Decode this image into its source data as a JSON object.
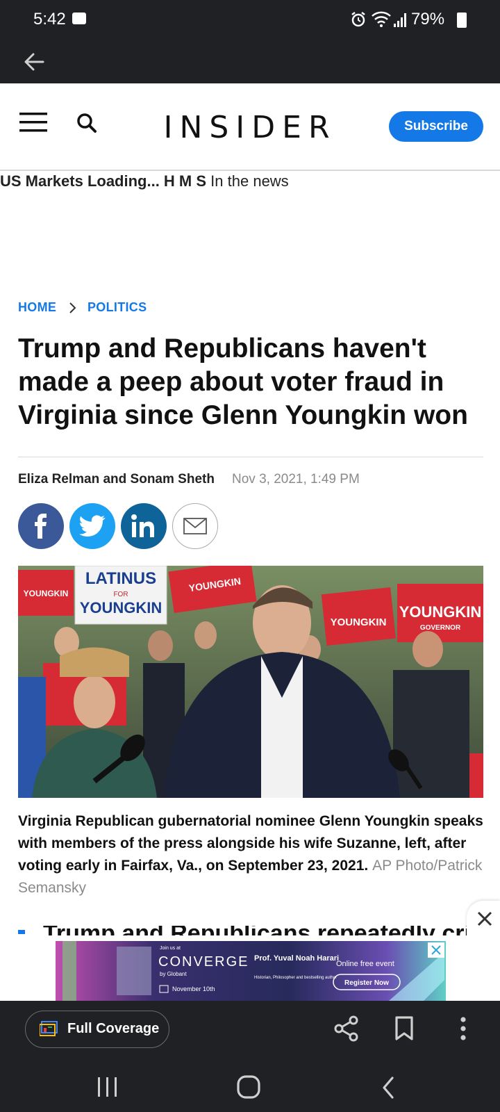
{
  "status_bar": {
    "time": "5:42",
    "battery": "79%"
  },
  "header": {
    "logo": "INSIDER",
    "subscribe_label": "Subscribe"
  },
  "ticker": {
    "markets": "US Markets Loading... H M S",
    "news": "In the news"
  },
  "breadcrumb": {
    "home": "HOME",
    "section": "POLITICS"
  },
  "article": {
    "headline": "Trump and Republicans haven't made a peep about voter fraud in Virginia since Glenn Youngkin won",
    "authors": "Eliza Relman and Sonam Sheth",
    "date": "Nov 3, 2021, 1:49 PM",
    "caption": "Virginia Republican gubernatorial nominee Glenn Youngkin speaks with members of the press alongside his wife Suzanne, left, after voting early in Fairfax, Va., on September 23, 2021.",
    "credit": "AP Photo/Patrick Semansky",
    "next_heading_partial": "Trump and Republicans repeatedly cried"
  },
  "photo_signs": {
    "latinus": "LATINUS",
    "for": "FOR",
    "youngkin": "YOUNGKIN",
    "governor": "GOVERNOR"
  },
  "ad": {
    "join": "Join us at",
    "brand": "CONVERGE",
    "by": "by Globant",
    "date": "November 10th",
    "speaker": "Prof. Yuval Noah Harari",
    "speaker_desc": "Historian, Philosopher and bestselling author",
    "event": "Online free event",
    "cta": "Register Now"
  },
  "bottom_bar": {
    "full_coverage_label": "Full Coverage"
  },
  "colors": {
    "accent": "#1479e6",
    "dark": "#202124",
    "facebook": "#3b5998",
    "twitter": "#1da1f2",
    "linkedin": "#0e6499"
  }
}
